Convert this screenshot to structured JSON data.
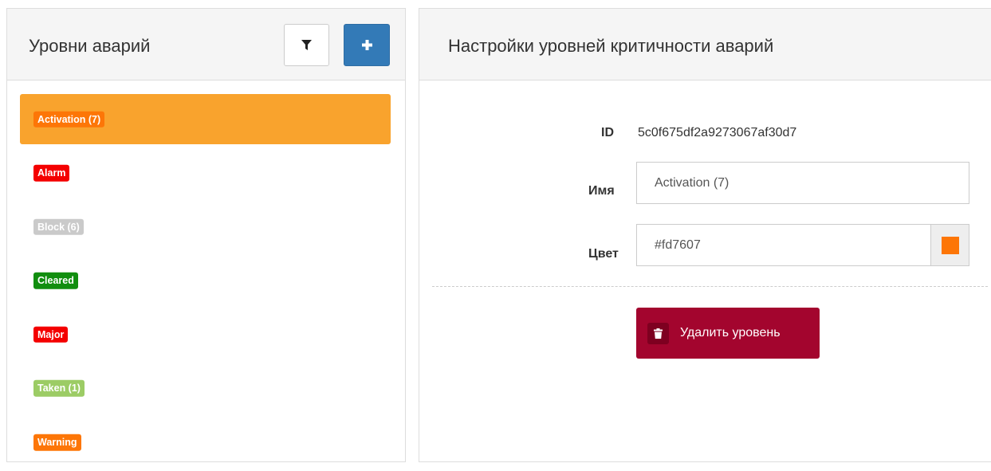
{
  "left_panel": {
    "title": "Уровни аварий",
    "filter_icon": "filter-icon",
    "add_icon": "plus-icon"
  },
  "levels": [
    {
      "label": "Activation (7)",
      "color": "#fd7607",
      "active": true
    },
    {
      "label": "Alarm",
      "color": "#f40000",
      "active": false
    },
    {
      "label": "Block (6)",
      "color": "#cacaca",
      "active": false
    },
    {
      "label": "Cleared",
      "color": "#118e0f",
      "active": false
    },
    {
      "label": "Major",
      "color": "#f40000",
      "active": false
    },
    {
      "label": "Taken (1)",
      "color": "#9ccc65",
      "active": false
    },
    {
      "label": "Warning",
      "color": "#fd7607",
      "active": false
    }
  ],
  "right_panel": {
    "title": "Настройки уровней критичности аварий",
    "id_label": "ID",
    "id_value": "5c0f675df2a9273067af30d7",
    "name_label": "Имя",
    "name_value": "Activation (7)",
    "color_label": "Цвет",
    "color_value": "#fd7607",
    "delete_label": "Удалить уровень",
    "delete_icon": "trash-icon"
  },
  "colors": {
    "active_item_bg": "#f9a32d",
    "primary": "#337ab7",
    "danger": "#a3052e"
  }
}
